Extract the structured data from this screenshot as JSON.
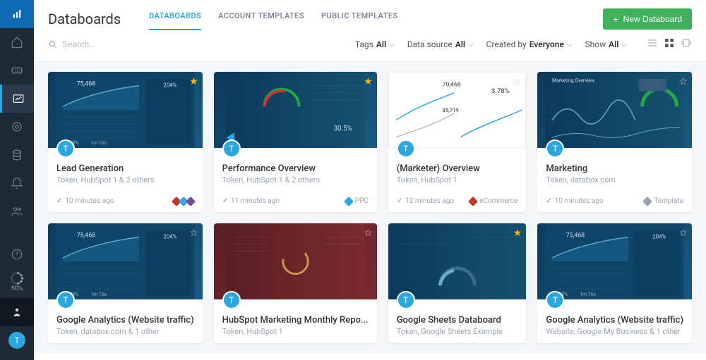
{
  "header": {
    "title": "Databoards",
    "tabs": [
      {
        "label": "DATABOARDS",
        "active": true
      },
      {
        "label": "ACCOUNT TEMPLATES",
        "active": false
      },
      {
        "label": "PUBLIC TEMPLATES",
        "active": false
      }
    ],
    "new_button": "New Databoard"
  },
  "toolbar": {
    "search_placeholder": "Search...",
    "filters": [
      {
        "label": "Tags",
        "value": "All"
      },
      {
        "label": "Data source",
        "value": "All"
      },
      {
        "label": "Created by",
        "value": "Everyone"
      },
      {
        "label": "Show",
        "value": "All"
      }
    ]
  },
  "sidebar": {
    "progress_pct": "50%",
    "avatar_initial": "T"
  },
  "cards": [
    {
      "title": "Lead Generation",
      "sub": "Token, HubSpot 1 & 2 others",
      "time": "10 minutes ago",
      "tag": "",
      "tag_color": "",
      "star": true,
      "thumb": "dark",
      "avatar": "T",
      "multi": true
    },
    {
      "title": "Performance Overview",
      "sub": "Token, HubSpot 1 & 2 others",
      "time": "11 minutes ago",
      "tag": "PPC",
      "tag_color": "#2aa7df",
      "star": true,
      "thumb": "dark-gauge",
      "avatar": "T"
    },
    {
      "title": "(Marketer) Overview",
      "sub": "Token, HubSpot 1",
      "time": "12 minutes ago",
      "tag": "eCommerce",
      "tag_color": "#c0392b",
      "star": false,
      "thumb": "light",
      "avatar": "T"
    },
    {
      "title": "Marketing",
      "sub": "Token, databox.com",
      "time": "10 minutes ago",
      "tag": "Template",
      "tag_color": "#9aa5b1",
      "star": false,
      "thumb": "dark-wave",
      "avatar": "T"
    },
    {
      "title": "Google Analytics (Website traffic)",
      "sub": "Token, databox.com & 1 other",
      "time": "",
      "tag": "",
      "tag_color": "",
      "star": false,
      "thumb": "dark",
      "avatar": "T",
      "nofooter": true
    },
    {
      "title": "HubSpot Marketing Monthly Repo...",
      "sub": "Token, HubSpot 1",
      "time": "",
      "tag": "",
      "tag_color": "",
      "star": false,
      "thumb": "red",
      "avatar": "T",
      "nofooter": true
    },
    {
      "title": "Google Sheets Databoard",
      "sub": "Token, Google Sheets Example",
      "time": "",
      "tag": "",
      "tag_color": "",
      "star": true,
      "thumb": "dark-gauge2",
      "avatar": "T",
      "nofooter": true
    },
    {
      "title": "Google Analytics (Website traffic)",
      "sub": "Website, Google My Business & 1 other",
      "time": "",
      "tag": "",
      "tag_color": "",
      "star": false,
      "thumb": "dark",
      "avatar": "T",
      "nofooter": true
    }
  ]
}
